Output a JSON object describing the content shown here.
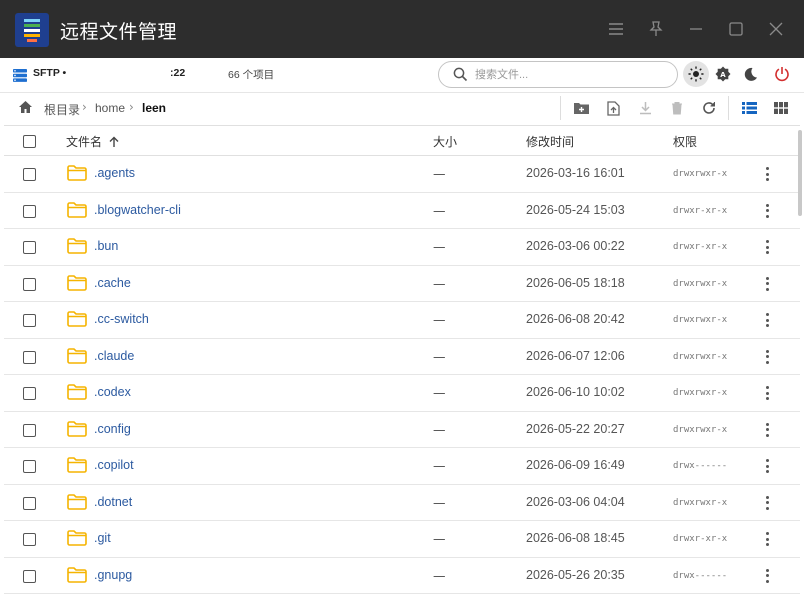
{
  "window": {
    "title": "远程文件管理"
  },
  "connection": {
    "protocol": "SFTP •",
    "port": ":22",
    "item_count": "66 个项目"
  },
  "search": {
    "placeholder": "搜索文件..."
  },
  "breadcrumb": [
    "根目录",
    "home",
    "leen"
  ],
  "table": {
    "headers": {
      "name": "文件名",
      "size": "大小",
      "mtime": "修改时间",
      "perm": "权限"
    },
    "rows": [
      {
        "name": ".agents",
        "size": "—",
        "mtime": "2026-03-16 16:01",
        "perm": "drwxrwxr-x"
      },
      {
        "name": ".blogwatcher-cli",
        "size": "—",
        "mtime": "2026-05-24 15:03",
        "perm": "drwxr-xr-x"
      },
      {
        "name": ".bun",
        "size": "—",
        "mtime": "2026-03-06 00:22",
        "perm": "drwxr-xr-x"
      },
      {
        "name": ".cache",
        "size": "—",
        "mtime": "2026-06-05 18:18",
        "perm": "drwxrwxr-x"
      },
      {
        "name": ".cc-switch",
        "size": "—",
        "mtime": "2026-06-08 20:42",
        "perm": "drwxrwxr-x"
      },
      {
        "name": ".claude",
        "size": "—",
        "mtime": "2026-06-07 12:06",
        "perm": "drwxrwxr-x"
      },
      {
        "name": ".codex",
        "size": "—",
        "mtime": "2026-06-10 10:02",
        "perm": "drwxrwxr-x"
      },
      {
        "name": ".config",
        "size": "—",
        "mtime": "2026-05-22 20:27",
        "perm": "drwxrwxr-x"
      },
      {
        "name": ".copilot",
        "size": "—",
        "mtime": "2026-06-09 16:49",
        "perm": "drwx------"
      },
      {
        "name": ".dotnet",
        "size": "—",
        "mtime": "2026-03-06 04:04",
        "perm": "drwxrwxr-x"
      },
      {
        "name": ".git",
        "size": "—",
        "mtime": "2026-06-08 18:45",
        "perm": "drwxr-xr-x"
      },
      {
        "name": ".gnupg",
        "size": "—",
        "mtime": "2026-05-26 20:35",
        "perm": "drwx------"
      }
    ]
  },
  "colors": {
    "titlebar": "#2d2d2d",
    "folder": "#f5b400",
    "link": "#2c5aa0",
    "power": "#d32f2f",
    "active_view": "#1565c0"
  },
  "icons": {
    "app": "app-logo-icon",
    "menu": "hamburger-icon",
    "pin": "pin-icon",
    "minimize": "minimize-icon",
    "maximize": "maximize-icon",
    "close": "close-icon",
    "server": "server-icon",
    "search": "search-icon",
    "light": "sun-icon",
    "auto": "auto-theme-icon",
    "dark": "moon-icon",
    "power": "power-icon",
    "home": "home-icon",
    "new_folder": "new-folder-icon",
    "upload": "upload-icon",
    "download": "download-icon",
    "delete": "trash-icon",
    "refresh": "refresh-icon",
    "list_view": "list-view-icon",
    "grid_view": "grid-view-icon",
    "folder": "folder-icon",
    "more": "more-vertical-icon",
    "sort": "sort-asc-icon"
  }
}
